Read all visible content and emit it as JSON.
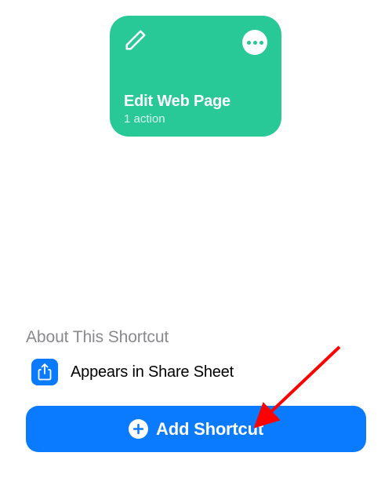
{
  "shortcut": {
    "title": "Edit Web Page",
    "subtitle": "1 action"
  },
  "section": {
    "header": "About This Shortcut",
    "share_sheet_label": "Appears in Share Sheet"
  },
  "button": {
    "add_label": "Add Shortcut"
  }
}
